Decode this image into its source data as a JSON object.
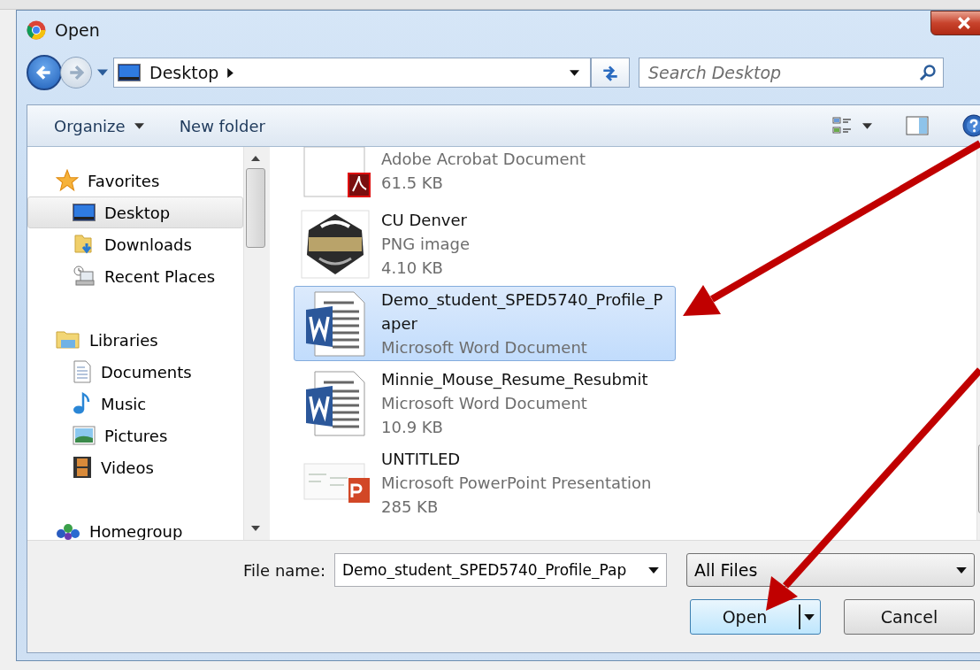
{
  "window": {
    "title": "Open"
  },
  "address_bar": {
    "location": "Desktop"
  },
  "search": {
    "placeholder": "Search Desktop"
  },
  "toolbar": {
    "buttons": [
      {
        "label": "Organize",
        "menu": true
      },
      {
        "label": "New folder",
        "menu": false
      }
    ]
  },
  "sidebar": {
    "groups": [
      {
        "label": "Favorites",
        "kind": "star",
        "children": [
          {
            "label": "Desktop",
            "kind": "desktop",
            "selected": true
          },
          {
            "label": "Downloads",
            "kind": "downloads",
            "selected": false
          },
          {
            "label": "Recent Places",
            "kind": "recent",
            "selected": false
          }
        ]
      },
      {
        "label": "Libraries",
        "kind": "libraries",
        "children": [
          {
            "label": "Documents",
            "kind": "documents",
            "selected": false
          },
          {
            "label": "Music",
            "kind": "music",
            "selected": false
          },
          {
            "label": "Pictures",
            "kind": "pictures",
            "selected": false
          },
          {
            "label": "Videos",
            "kind": "videos",
            "selected": false
          }
        ]
      },
      {
        "label": "Homegroup",
        "kind": "homegroup"
      }
    ]
  },
  "files": [
    {
      "kind": "pdf",
      "type": "Adobe Acrobat Document",
      "size": "61.5 KB",
      "selected": false
    },
    {
      "kind": "image",
      "name": "CU Denver",
      "type": "PNG image",
      "size": "4.10 KB",
      "selected": false
    },
    {
      "kind": "word",
      "name": "Demo_student_SPED5740_Profile_Paper",
      "type": "Microsoft Word Document",
      "selected": true
    },
    {
      "kind": "word",
      "name": "Minnie_Mouse_Resume_Resubmit",
      "type": "Microsoft Word Document",
      "size": "10.9 KB",
      "selected": false
    },
    {
      "kind": "powerpoint",
      "name": "UNTITLED",
      "type": "Microsoft PowerPoint Presentation",
      "size": "285 KB",
      "selected": false
    }
  ],
  "footer": {
    "file_name_label": "File name:",
    "file_name": "Demo_student_SPED5740_Profile_Pap",
    "file_type": "All Files",
    "buttons": [
      {
        "label": "Open",
        "kind": "split"
      },
      {
        "label": "Cancel",
        "kind": "plain"
      }
    ]
  }
}
